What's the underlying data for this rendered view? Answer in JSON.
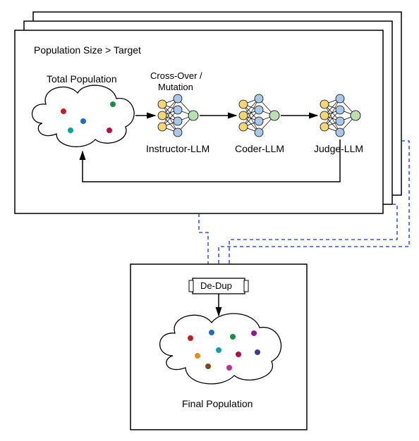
{
  "labels": {
    "condition": "Population Size > Target",
    "total_population": "Total Population",
    "crossover": "Cross-Over /",
    "mutation": "Mutation",
    "instructor": "Instructor-LLM",
    "coder": "Coder-LLM",
    "judge": "Judge-LLM",
    "dedup": "De-Dup",
    "final_population": "Final Population"
  },
  "colors": {
    "panel_stroke": "#000000",
    "arrow": "#000000",
    "dashed": "#0033ff",
    "cloud_fill": "#ffffff",
    "nn_input": "#f5d675",
    "nn_hidden": "#a8c8e8",
    "nn_output": "#b8e0b0",
    "dots": [
      "#c71c1c",
      "#1c6dc7",
      "#17903b",
      "#8f1c8f",
      "#b50f3f",
      "#e09018",
      "#0aa3a3",
      "#3b3b9a",
      "#7a4c1a",
      "#b82fa0"
    ]
  }
}
